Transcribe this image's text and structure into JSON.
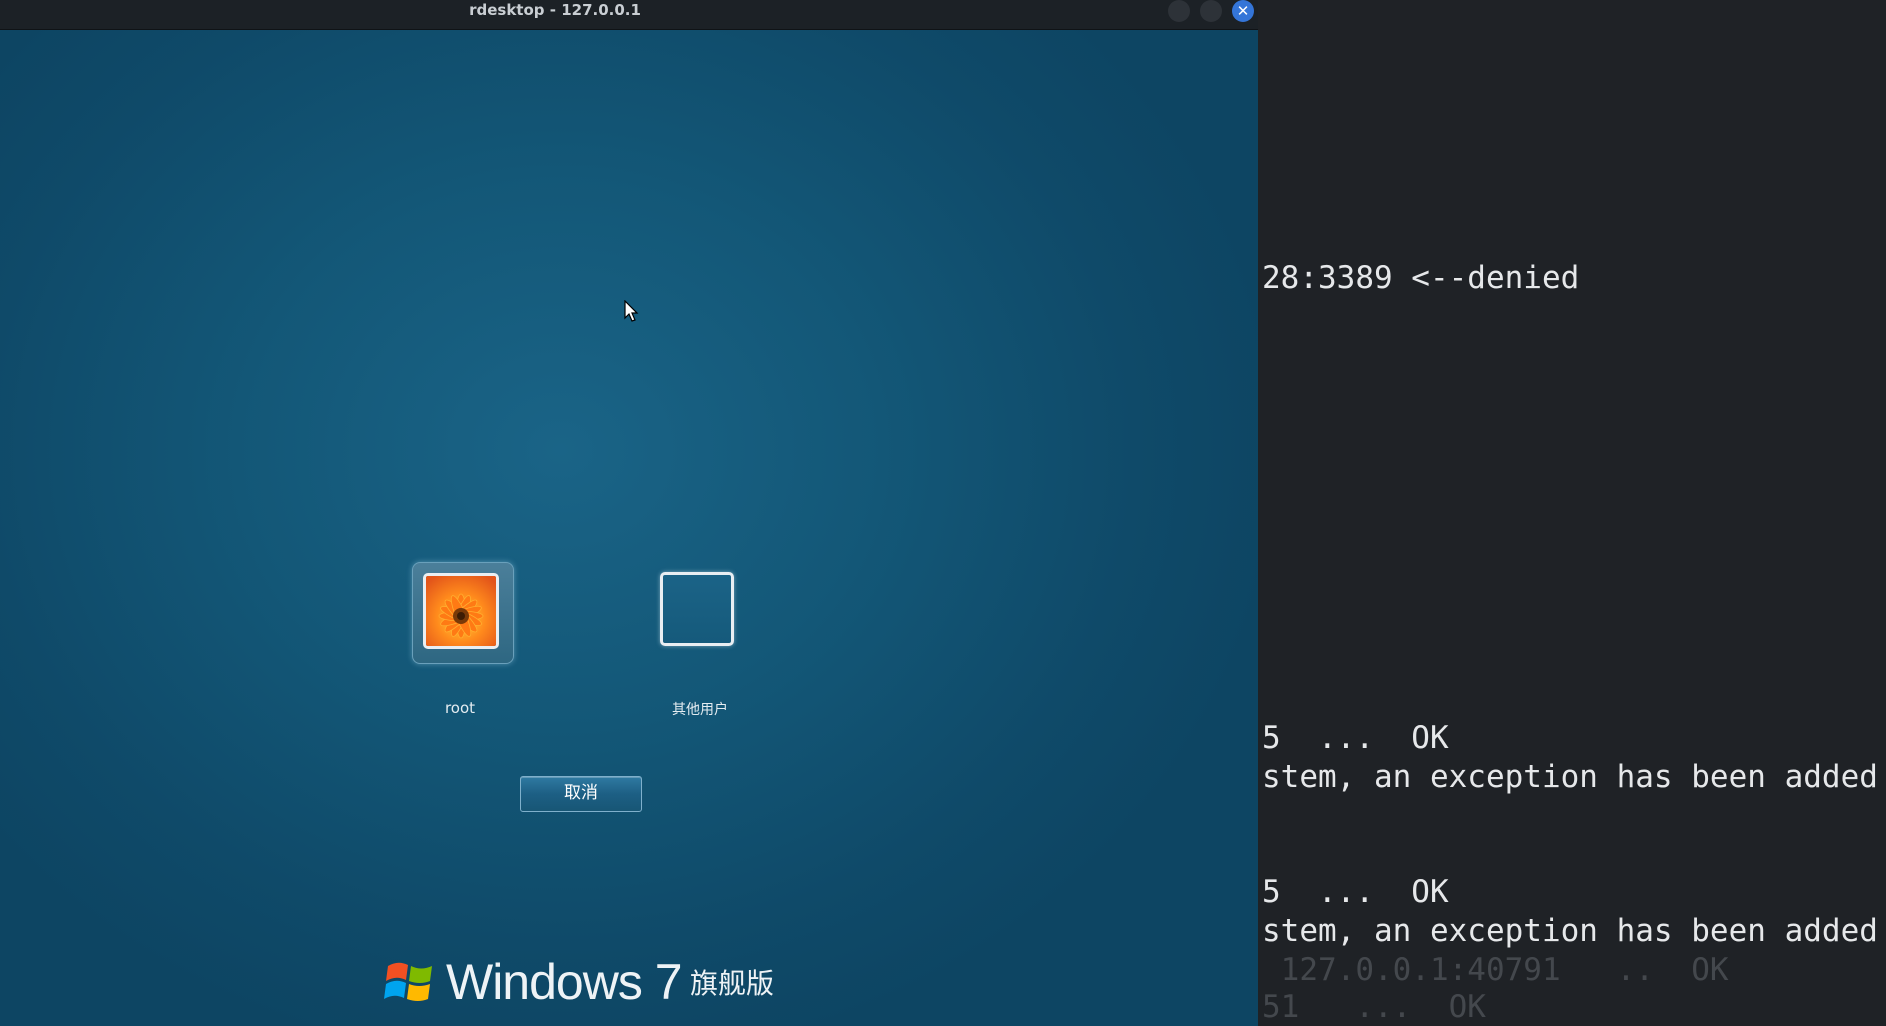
{
  "window": {
    "title": "rdesktop - 127.0.0.1",
    "close_glyph": "✕"
  },
  "login": {
    "users": [
      {
        "label": "root"
      },
      {
        "label": "其他用户"
      }
    ],
    "cancel_label": "取消",
    "brand": {
      "wordmark": "Windows 7",
      "edition": "旗舰版"
    }
  },
  "terminal": {
    "lines": [
      "28:3389 <--denied",
      "5  ...  OK",
      "stem, an exception has been added",
      "5  ...  OK",
      "stem, an exception has been added",
      " 127.0.0.1:40791   ..  OK",
      "51   ...  OK"
    ]
  },
  "colors": {
    "titlebar": "#1c2126",
    "close_accent": "#3475d8",
    "login_background": "#135777",
    "terminal_background": "#1f2226",
    "terminal_text": "#e6e8ea"
  }
}
